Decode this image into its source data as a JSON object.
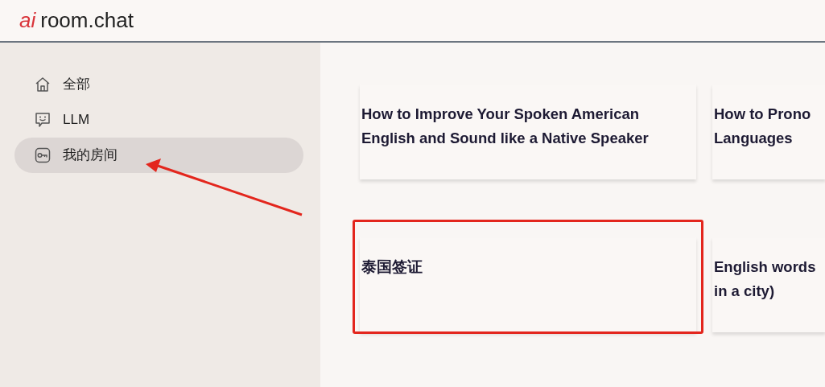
{
  "header": {
    "logo_mark": "ai",
    "site_name": "room.chat"
  },
  "sidebar": {
    "items": [
      {
        "kind": "home",
        "label": "全部",
        "selected": false,
        "pointed_at": false
      },
      {
        "kind": "chat",
        "label": "LLM",
        "selected": false,
        "pointed_at": false
      },
      {
        "kind": "key",
        "label": "我的房间",
        "selected": true,
        "pointed_at": true
      }
    ]
  },
  "cards": [
    {
      "lines": [
        "How to Improve Your Spoken American",
        "English and Sound like a Native Speaker"
      ],
      "highlighted": false
    },
    {
      "lines": [
        "How to Prono",
        "Languages"
      ],
      "highlighted": false
    },
    {
      "lines": [
        "泰国签证"
      ],
      "highlighted": true
    },
    {
      "lines": [
        "English words",
        "in a city)"
      ],
      "highlighted": false
    }
  ]
}
